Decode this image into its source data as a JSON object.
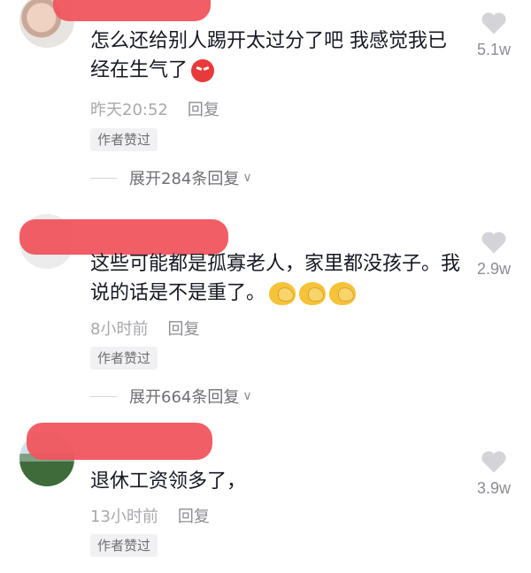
{
  "comments": [
    {
      "text": "怎么还给别人踢开太过分了吧 我感觉我已经在生气了",
      "emoji": "angry-face-icon",
      "time": "昨天20:52",
      "reply": "回复",
      "badge": "作者赞过",
      "expand": "展开284条回复",
      "likes": "5.1w"
    },
    {
      "text": "这些可能都是孤寡老人，家里都没孩子。我说的话是不是重了。",
      "emoji": "facepalm-icon",
      "time": "8小时前",
      "reply": "回复",
      "badge": "作者赞过",
      "expand": "展开664条回复",
      "likes": "2.9w"
    },
    {
      "text": "退休工资领多了，",
      "time": "13小时前",
      "reply": "回复",
      "badge": "作者赞过",
      "likes": "3.9w"
    }
  ],
  "colors": {
    "redaction": "#f0555d",
    "meta": "#a8a8ad",
    "like_icon": "#d4d4d8"
  }
}
